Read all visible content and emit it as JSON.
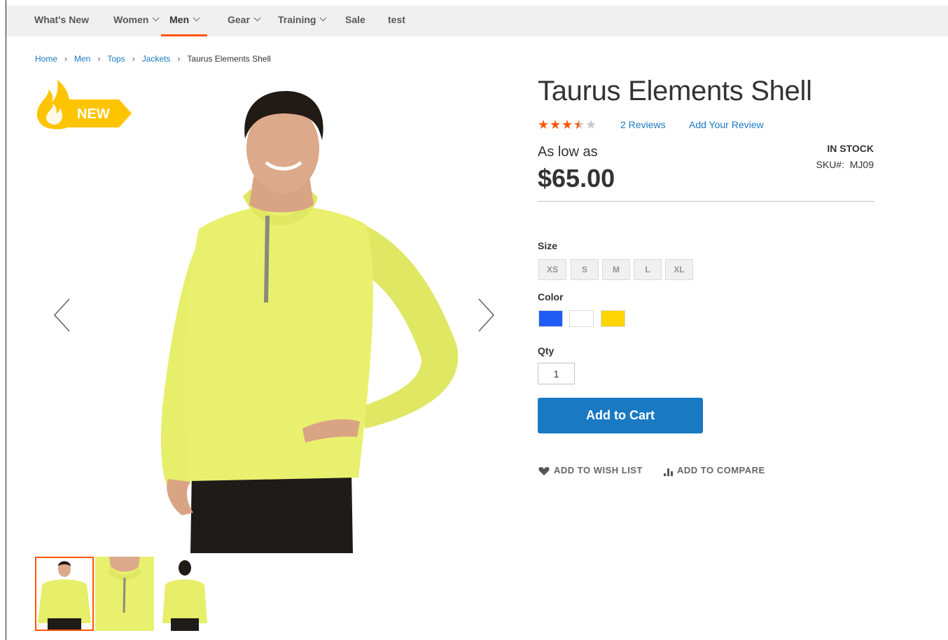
{
  "nav": {
    "items": [
      {
        "label": "What's New",
        "dropdown": false,
        "active": false
      },
      {
        "label": "Women",
        "dropdown": true,
        "active": false
      },
      {
        "label": "Men",
        "dropdown": true,
        "active": true
      },
      {
        "label": "Gear",
        "dropdown": true,
        "active": false
      },
      {
        "label": "Training",
        "dropdown": true,
        "active": false
      },
      {
        "label": "Sale",
        "dropdown": false,
        "active": false
      },
      {
        "label": "test",
        "dropdown": false,
        "active": false
      }
    ]
  },
  "breadcrumb": {
    "items": [
      "Home",
      "Men",
      "Tops",
      "Jackets"
    ],
    "current": "Taurus Elements Shell"
  },
  "badge": {
    "label": "NEW"
  },
  "gallery": {
    "thumbnails": [
      "front view",
      "collar close-up",
      "back view"
    ],
    "active_thumbnail": 0
  },
  "product": {
    "name": "Taurus Elements Shell",
    "rating": 3.5,
    "rating_max": 5,
    "reviews_link": "2  Reviews",
    "add_review_link": "Add Your Review",
    "price_prefix": "As low as",
    "price": "$65.00",
    "stock": "IN STOCK",
    "sku_label": "SKU#:",
    "sku": "MJ09"
  },
  "options": {
    "size_label": "Size",
    "sizes": [
      "XS",
      "S",
      "M",
      "L",
      "XL"
    ],
    "color_label": "Color",
    "colors": [
      "#1f5cf5",
      "#ffffff",
      "#ffd500"
    ],
    "qty_label": "Qty",
    "qty_value": "1"
  },
  "actions": {
    "add_to_cart": "Add to Cart",
    "wishlist": "ADD TO WISH LIST",
    "compare": "ADD TO COMPARE"
  },
  "colors": {
    "accent": "#ff5501",
    "link": "#1979c3",
    "button": "#1979c3",
    "nav_bg": "#f0f0f0"
  }
}
